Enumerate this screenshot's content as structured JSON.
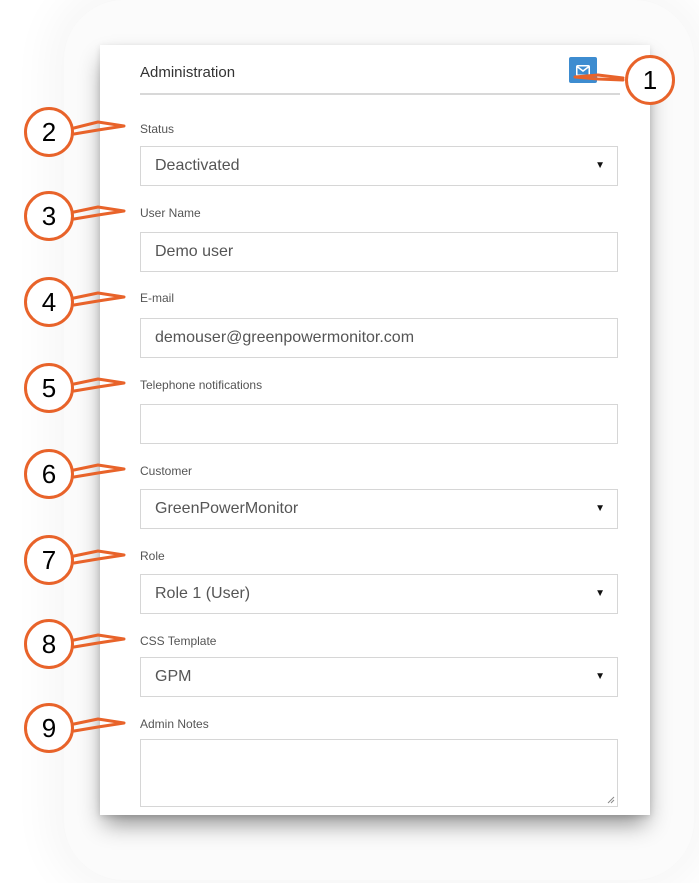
{
  "panel": {
    "title": "Administration",
    "mail_icon": "envelope-icon"
  },
  "fields": {
    "status": {
      "label": "Status",
      "value": "Deactivated",
      "type": "select"
    },
    "user_name": {
      "label": "User Name",
      "value": "Demo user",
      "type": "text"
    },
    "email": {
      "label": "E-mail",
      "value": "demouser@greenpowermonitor.com",
      "type": "text"
    },
    "telephone": {
      "label": "Telephone notifications",
      "value": "",
      "type": "text"
    },
    "customer": {
      "label": "Customer",
      "value": "GreenPowerMonitor",
      "type": "select"
    },
    "role": {
      "label": "Role",
      "value": "Role 1 (User)",
      "type": "select"
    },
    "css_template": {
      "label": "CSS Template",
      "value": "GPM",
      "type": "select"
    },
    "admin_notes": {
      "label": "Admin Notes",
      "value": "",
      "type": "textarea"
    }
  },
  "callouts": [
    "1",
    "2",
    "3",
    "4",
    "5",
    "6",
    "7",
    "8",
    "9"
  ],
  "colors": {
    "callout_orange": "#e8632a",
    "button_blue": "#3d8cd0"
  },
  "select_caret": "▼"
}
